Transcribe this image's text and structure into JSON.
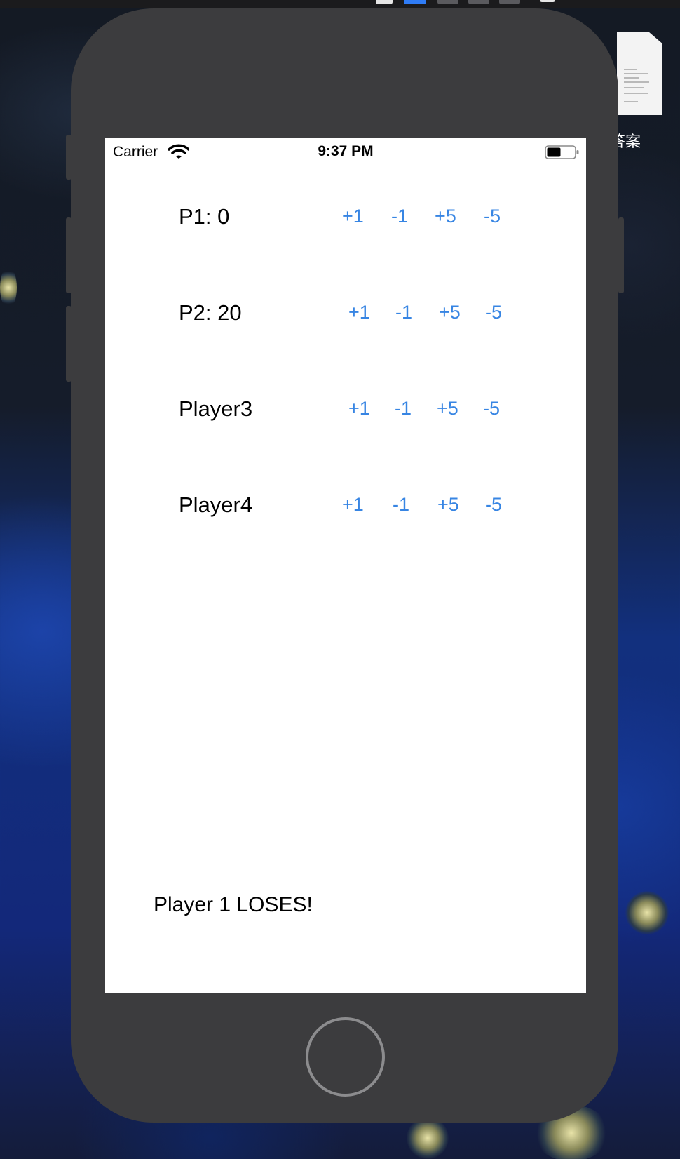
{
  "desktop": {
    "file_label": "答案"
  },
  "phone": {
    "status_bar": {
      "carrier": "Carrier",
      "time": "9:37 PM",
      "battery_level": 0.5
    },
    "players": [
      {
        "label": "P1: 0",
        "buttons": [
          "+1",
          "-1",
          "+5",
          "-5"
        ]
      },
      {
        "label": "P2: 20",
        "buttons": [
          "+1",
          "-1",
          "+5",
          "-5"
        ]
      },
      {
        "label": "Player3",
        "buttons": [
          "+1",
          "-1",
          "+5",
          "-5"
        ]
      },
      {
        "label": "Player4",
        "buttons": [
          "+1",
          "-1",
          "+5",
          "-5"
        ]
      }
    ],
    "result_message": "Player 1 LOSES!"
  },
  "colors": {
    "button_tint": "#3785e3",
    "device_body": "#3c3c3e",
    "screen_background": "#ffffff"
  }
}
